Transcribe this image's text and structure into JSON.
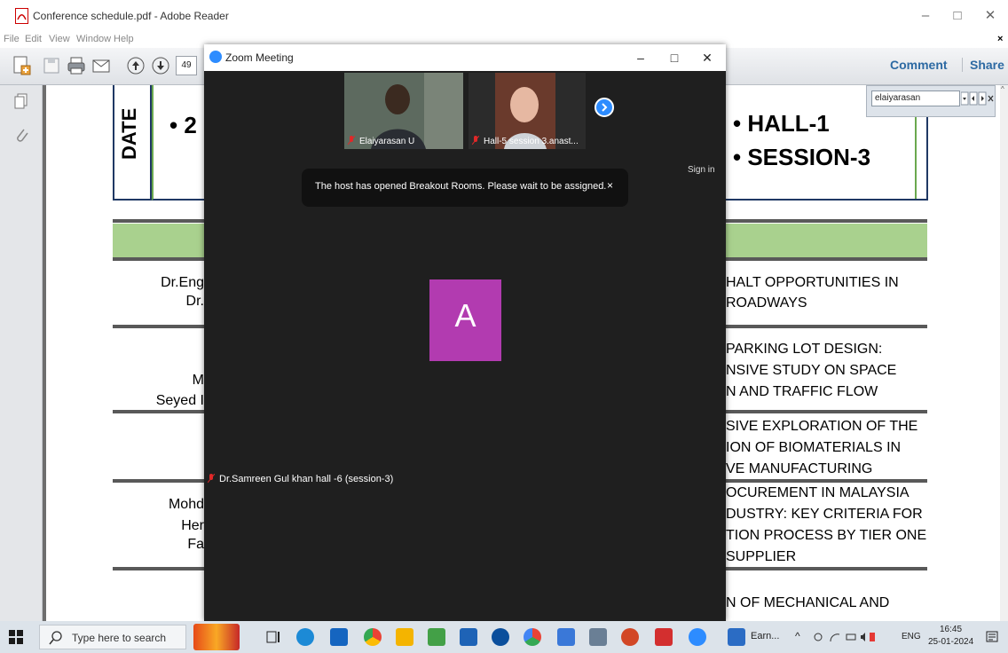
{
  "reader": {
    "window_title": "Conference schedule.pdf - Adobe Reader",
    "menu": [
      "File",
      "Edit",
      "View",
      "Window",
      "Help"
    ],
    "page_number": "49",
    "comment_label": "Comment",
    "share_label": "Share",
    "find_value": "elaiyarasan",
    "close_doc_glyph": "×"
  },
  "pdf": {
    "date_label": "DATE",
    "date_bullet": "• 2",
    "hall": "• HALL-1",
    "session": "• SESSION-3",
    "rows": [
      {
        "left": [
          "Dr.Eng",
          "Dr."
        ],
        "right": [
          "HALT OPPORTUNITIES IN",
          "ROADWAYS"
        ]
      },
      {
        "left": [
          "M",
          "Seyed I"
        ],
        "right": [
          "PARKING LOT DESIGN:",
          "NSIVE STUDY ON SPACE",
          "N AND TRAFFIC FLOW"
        ]
      },
      {
        "left": [],
        "right": [
          "SIVE EXPLORATION OF THE",
          "ION OF BIOMATERIALS IN",
          "VE MANUFACTURING"
        ]
      },
      {
        "left": [
          "Mohd",
          "Her",
          "Fa"
        ],
        "right": [
          "OCUREMENT IN MALAYSIA",
          "DUSTRY: KEY CRITERIA FOR",
          "TION PROCESS BY TIER ONE",
          "SUPPLIER"
        ]
      },
      {
        "left": [],
        "right": [
          "N OF MECHANICAL AND"
        ]
      }
    ]
  },
  "zoom": {
    "window_title": "Zoom Meeting",
    "participants": [
      {
        "name": "Elaiyarasan U"
      },
      {
        "name": "Hall-5 session 3.anast..."
      }
    ],
    "sign_in": "Sign in",
    "banner_text": "The host has opened Breakout Rooms. Please wait to be assigned.",
    "banner_close": "×",
    "avatar_letter": "A",
    "active_speaker": "Dr.Samreen Gul khan hall -6 (session-3)"
  },
  "taskbar": {
    "search_placeholder": "Type here to search",
    "earn_label": "Earn...",
    "language": "ENG",
    "time": "16:45",
    "date": "25-01-2024"
  },
  "colors": {
    "zoom_blue": "#2d8cff",
    "avatar_purple": "#b23bb0",
    "green_band": "#a9d18e",
    "reader_link_blue": "#2d6aa3"
  }
}
